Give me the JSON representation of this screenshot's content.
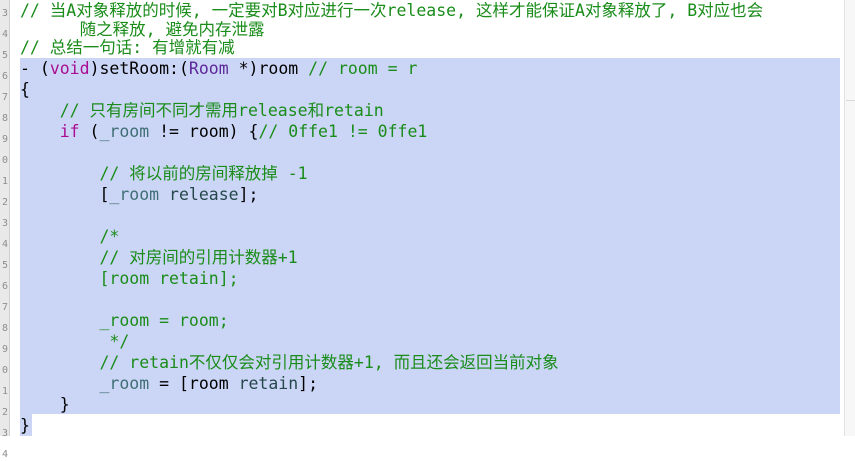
{
  "gutter_numbers": [
    "3",
    "4",
    "5",
    "6",
    "7",
    "8",
    "9",
    "0",
    "1",
    "2",
    "3",
    "4",
    "5",
    "6",
    "7",
    "8",
    "9",
    "0",
    "1",
    "2",
    "3",
    "4"
  ],
  "lines": [
    {
      "indent": "",
      "segs": [
        {
          "cls": "c",
          "text": "// 当A对象释放的时候, 一定要对B对应进行一次release, 这样才能保证A对象释放了, B对应也会"
        }
      ]
    },
    {
      "indent": "      ",
      "segs": [
        {
          "cls": "c",
          "text": "随之释放, 避免内存泄露"
        }
      ]
    },
    {
      "indent": "",
      "segs": [
        {
          "cls": "c",
          "text": "// 总结一句话: 有增就有减"
        }
      ]
    },
    {
      "indent": "",
      "segs": [
        {
          "cls": "",
          "text": "- ("
        },
        {
          "cls": "k",
          "text": "void"
        },
        {
          "cls": "",
          "text": ")setRoom:("
        },
        {
          "cls": "t",
          "text": "Room"
        },
        {
          "cls": "",
          "text": " *)room "
        },
        {
          "cls": "c",
          "text": "// room = r"
        }
      ]
    },
    {
      "indent": "",
      "segs": [
        {
          "cls": "",
          "text": "{"
        }
      ]
    },
    {
      "indent": "    ",
      "segs": [
        {
          "cls": "c",
          "text": "// 只有房间不同才需用release和retain"
        }
      ]
    },
    {
      "indent": "    ",
      "segs": [
        {
          "cls": "k",
          "text": "if"
        },
        {
          "cls": "",
          "text": " ("
        },
        {
          "cls": "i",
          "text": "_room"
        },
        {
          "cls": "",
          "text": " != room) {"
        },
        {
          "cls": "c",
          "text": "// 0ffe1 != 0ffe1"
        }
      ]
    },
    {
      "indent": "",
      "segs": [
        {
          "cls": "",
          "text": ""
        }
      ]
    },
    {
      "indent": "        ",
      "segs": [
        {
          "cls": "c",
          "text": "// 将以前的房间释放掉 -1"
        }
      ]
    },
    {
      "indent": "        ",
      "segs": [
        {
          "cls": "",
          "text": "["
        },
        {
          "cls": "i",
          "text": "_room"
        },
        {
          "cls": "",
          "text": " "
        },
        {
          "cls": "m",
          "text": "release"
        },
        {
          "cls": "",
          "text": "];"
        }
      ]
    },
    {
      "indent": "",
      "segs": [
        {
          "cls": "",
          "text": ""
        }
      ]
    },
    {
      "indent": "        ",
      "segs": [
        {
          "cls": "c",
          "text": "/*"
        }
      ]
    },
    {
      "indent": "        ",
      "segs": [
        {
          "cls": "c",
          "text": "// 对房间的引用计数器+1"
        }
      ]
    },
    {
      "indent": "        ",
      "segs": [
        {
          "cls": "c",
          "text": "[room retain];"
        }
      ]
    },
    {
      "indent": "",
      "segs": [
        {
          "cls": "",
          "text": ""
        }
      ]
    },
    {
      "indent": "        ",
      "segs": [
        {
          "cls": "c",
          "text": "_room = room;"
        }
      ]
    },
    {
      "indent": "         ",
      "segs": [
        {
          "cls": "c",
          "text": "*/"
        }
      ]
    },
    {
      "indent": "        ",
      "segs": [
        {
          "cls": "c",
          "text": "// retain不仅仅会对引用计数器+1, 而且还会返回当前对象"
        }
      ]
    },
    {
      "indent": "        ",
      "segs": [
        {
          "cls": "i",
          "text": "_room"
        },
        {
          "cls": "",
          "text": " = [room "
        },
        {
          "cls": "m",
          "text": "retain"
        },
        {
          "cls": "",
          "text": "];"
        }
      ]
    },
    {
      "indent": "    ",
      "segs": [
        {
          "cls": "",
          "text": "}"
        }
      ]
    },
    {
      "indent": "",
      "segs": [
        {
          "cls": "",
          "text": "}"
        }
      ]
    }
  ]
}
